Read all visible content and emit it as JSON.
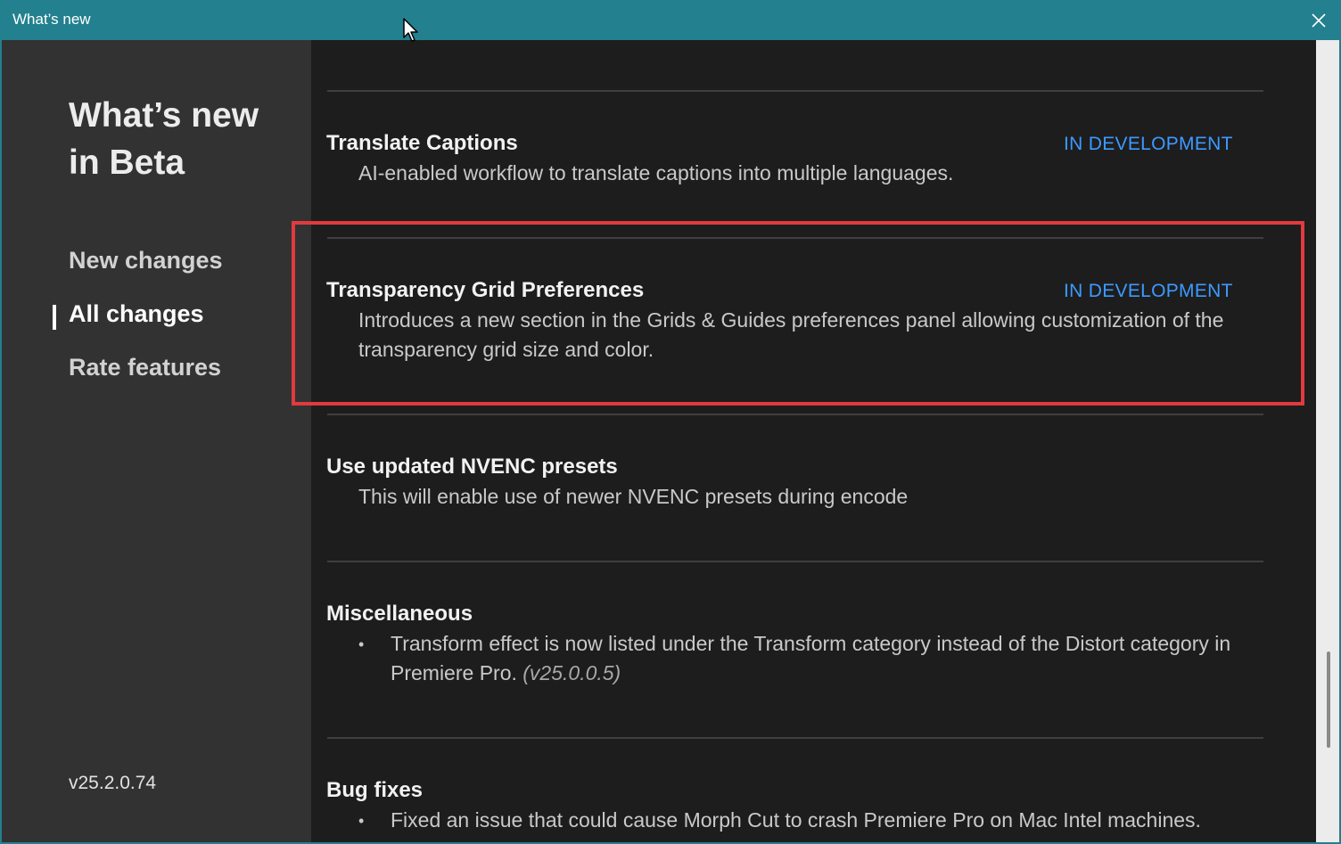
{
  "window": {
    "title": "What’s new"
  },
  "sidebar": {
    "heading_line1": "What’s new",
    "heading_line2": "in Beta",
    "items": [
      {
        "label": "New changes",
        "active": false
      },
      {
        "label": "All changes",
        "active": true
      },
      {
        "label": "Rate features",
        "active": false
      }
    ],
    "version": "v25.2.0.74"
  },
  "features": [
    {
      "title": "Translate Captions",
      "status": "IN DEVELOPMENT",
      "description": "AI-enabled workflow to translate captions into multiple languages."
    },
    {
      "title": "Transparency Grid Preferences",
      "status": "IN DEVELOPMENT",
      "description": "Introduces a new section in the Grids & Guides preferences panel allowing customization of the transparency grid size and color."
    },
    {
      "title": "Use updated NVENC presets",
      "status": "",
      "description": "This will enable use of newer NVENC presets during encode"
    }
  ],
  "miscellaneous": {
    "title": "Miscellaneous",
    "items": [
      {
        "text": "Transform effect is now listed under the Transform category instead of the Distort category in Premiere Pro.",
        "version": "(v25.0.0.5)"
      }
    ]
  },
  "bug_fixes": {
    "title": "Bug fixes",
    "items": [
      {
        "text": "Fixed an issue that could cause Morph Cut to crash Premiere Pro on Mac Intel machines."
      }
    ]
  },
  "icons": {
    "close": "close-icon",
    "cursor": "mouse-pointer-icon",
    "bullet": "•"
  },
  "colors": {
    "titlebar": "#22808f",
    "sidebar": "#323232",
    "content": "#1d1d1d",
    "status": "#3d9aff",
    "highlight": "#e13a3f"
  }
}
